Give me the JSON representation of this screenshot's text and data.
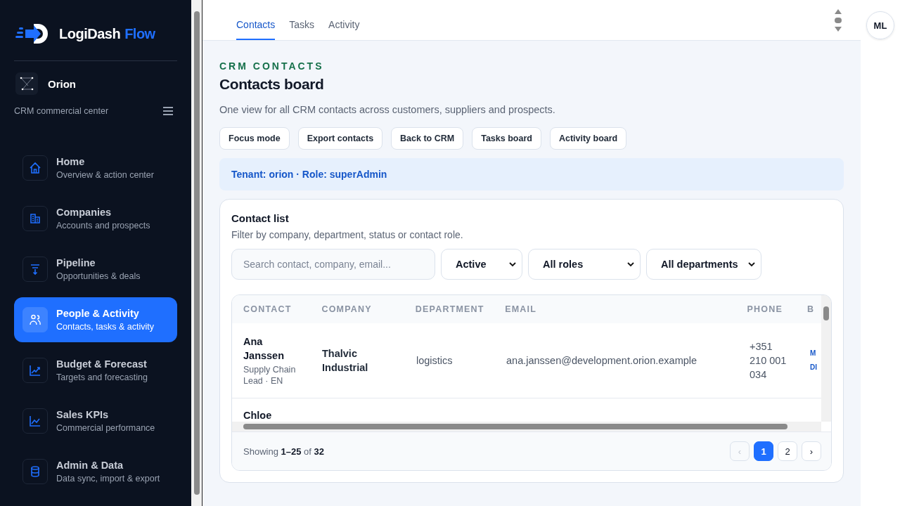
{
  "brand": {
    "name": "LogiDash",
    "accent": "Flow"
  },
  "workspace": {
    "name": "Orion",
    "subtitle": "CRM commercial center"
  },
  "nav": [
    {
      "kind": "home",
      "label": "Home",
      "sub": "Overview & action center",
      "selected": false
    },
    {
      "kind": "companies",
      "label": "Companies",
      "sub": "Accounts and prospects",
      "selected": false
    },
    {
      "kind": "pipeline",
      "label": "Pipeline",
      "sub": "Opportunities & deals",
      "selected": false
    },
    {
      "kind": "people",
      "label": "People & Activity",
      "sub": "Contacts, tasks & activity",
      "selected": true
    },
    {
      "kind": "budget",
      "label": "Budget & Forecast",
      "sub": "Targets and forecasting",
      "selected": false
    },
    {
      "kind": "kpi",
      "label": "Sales KPIs",
      "sub": "Commercial performance",
      "selected": false
    },
    {
      "kind": "data",
      "label": "Admin & Data",
      "sub": "Data sync, import & export",
      "selected": false
    }
  ],
  "tabs": [
    {
      "label": "Contacts",
      "selected": true
    },
    {
      "label": "Tasks",
      "selected": false
    },
    {
      "label": "Activity",
      "selected": false
    }
  ],
  "avatar": "ML",
  "eyebrow": "CRM CONTACTS",
  "title": "Contacts board",
  "description": "One view for all CRM contacts across customers, suppliers and prospects.",
  "actions": [
    "Focus mode",
    "Export contacts",
    "Back to CRM",
    "Tasks board",
    "Activity board"
  ],
  "notice": "Tenant: orion · Role: superAdmin",
  "list": {
    "title": "Contact list",
    "subtitle": "Filter by company, department, status or contact role.",
    "search": {
      "placeholder": "Search contact, company, email..."
    },
    "filters": [
      "Active",
      "All roles",
      "All departments"
    ],
    "columns": [
      "CONTACT",
      "COMPANY",
      "DEPARTMENT",
      "EMAIL",
      "PHONE",
      "B"
    ],
    "rows": [
      {
        "contact": "Ana Janssen",
        "meta": "Supply Chain Lead · EN",
        "company": "Thalvic Industrial",
        "department": "logistics",
        "email": "ana.janssen@development.orion.example",
        "phone": "+351 210 001 034",
        "column_6": [
          "M",
          "DI"
        ]
      },
      {
        "contact": "Chloe"
      }
    ],
    "footer": "Showing **1–25** of **32**",
    "pages": [
      {
        "label": "‹",
        "disabled": true,
        "selected": false
      },
      {
        "label": "1",
        "disabled": false,
        "selected": true
      },
      {
        "label": "2",
        "disabled": false,
        "selected": false
      },
      {
        "label": "›",
        "disabled": false,
        "selected": false
      }
    ]
  }
}
